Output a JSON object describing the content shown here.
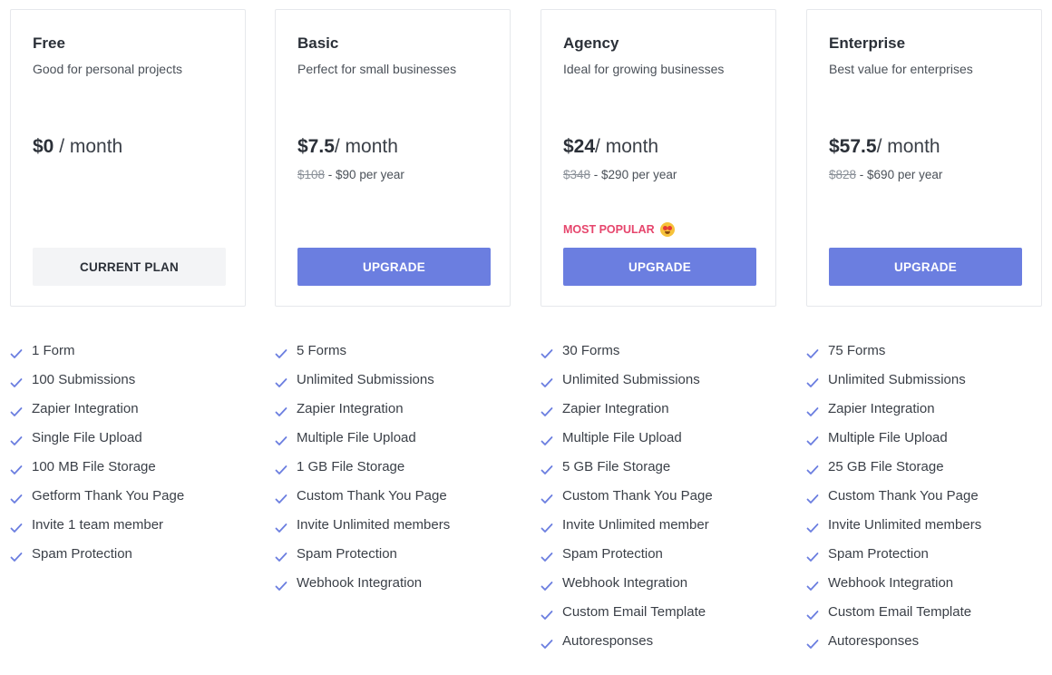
{
  "plans": [
    {
      "name": "Free",
      "description": "Good for personal projects",
      "price": "$0",
      "period": " / month",
      "old_year": "",
      "new_year": "",
      "badge": "",
      "button": "CURRENT PLAN",
      "features": [
        "1 Form",
        "100 Submissions",
        "Zapier Integration",
        "Single File Upload",
        "100 MB File Storage",
        "Getform Thank You Page",
        "Invite 1 team member",
        "Spam Protection"
      ]
    },
    {
      "name": "Basic",
      "description": "Perfect for small businesses",
      "price": "$7.5",
      "period": "/ month",
      "old_year": "$108",
      "new_year": " - $90 per year",
      "badge": "",
      "button": "UPGRADE",
      "features": [
        "5 Forms",
        "Unlimited Submissions",
        "Zapier Integration",
        "Multiple File Upload",
        "1 GB File Storage",
        "Custom Thank You Page",
        "Invite Unlimited members",
        "Spam Protection",
        "Webhook Integration"
      ]
    },
    {
      "name": "Agency",
      "description": "Ideal for growing businesses",
      "price": "$24",
      "period": "/ month",
      "old_year": "$348",
      "new_year": " - $290 per year",
      "badge": "MOST POPULAR",
      "badge_icon": "star-struck-emoji-icon",
      "button": "UPGRADE",
      "features": [
        "30 Forms",
        "Unlimited Submissions",
        "Zapier Integration",
        "Multiple File Upload",
        "5 GB File Storage",
        "Custom Thank You Page",
        "Invite Unlimited member",
        "Spam Protection",
        "Webhook Integration",
        "Custom Email Template",
        "Autoresponses"
      ]
    },
    {
      "name": "Enterprise",
      "description": "Best value for enterprises",
      "price": "$57.5",
      "period": "/ month",
      "old_year": "$828",
      "new_year": " - $690 per year",
      "badge": "",
      "button": "UPGRADE",
      "features": [
        "75 Forms",
        "Unlimited Submissions",
        "Zapier Integration",
        "Multiple File Upload",
        "25 GB File Storage",
        "Custom Thank You Page",
        "Invite Unlimited members",
        "Spam Protection",
        "Webhook Integration",
        "Custom Email Template",
        "Autoresponses"
      ]
    }
  ],
  "colors": {
    "accent": "#6b7ee0",
    "popular": "#e6456c",
    "check": "#6b7ee0",
    "current_button_bg": "#f3f4f6"
  },
  "icons": {
    "feature_check": "check-icon"
  }
}
